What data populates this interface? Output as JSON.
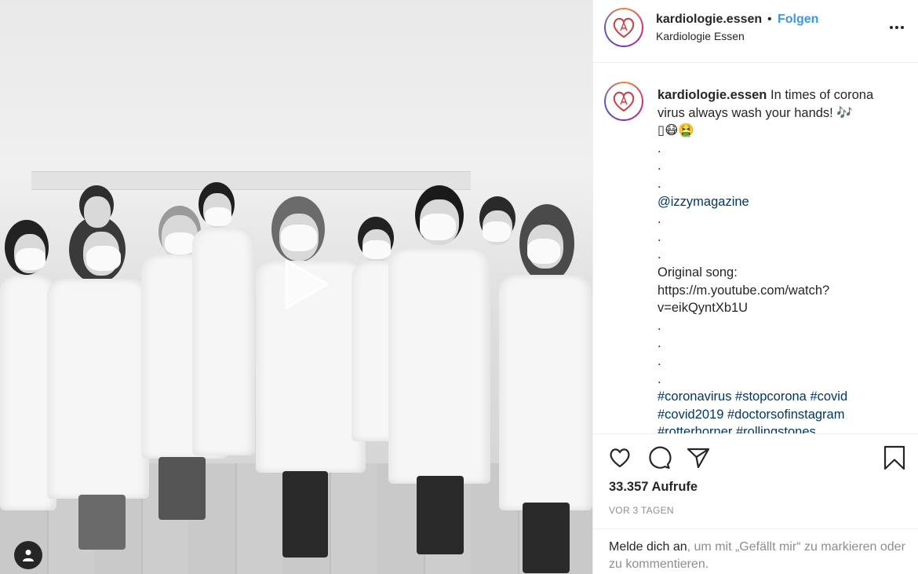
{
  "post": {
    "username": "kardiologie.essen",
    "separator": "•",
    "follow_label": "Folgen",
    "location": "Kardiologie Essen",
    "more_icon": "more-horizontal-icon"
  },
  "media": {
    "type": "video",
    "play_icon": "play-icon",
    "user_tag_icon": "user-tag-icon"
  },
  "caption": {
    "username": "kardiologie.essen",
    "lines": [
      "In times of corona",
      "virus always wash your hands! 🎶",
      "▯😷🤮",
      ".",
      ".",
      ".",
      "@izzymagazine",
      ".",
      ".",
      ".",
      "Original song:",
      "https://m.youtube.com/watch?",
      "v=eikQyntXb1U",
      ".",
      ".",
      ".",
      ".",
      "#coronavirus #stopcorona #covid",
      "#covid2019 #doctorsofinstagram",
      "#rotterhorner #rollingstones"
    ]
  },
  "actions": {
    "like_icon": "heart-icon",
    "comment_icon": "comment-icon",
    "share_icon": "share-icon",
    "save_icon": "bookmark-icon",
    "views": "33.357 Aufrufe",
    "timestamp": "VOR 3 TAGEN",
    "login_link": "Melde dich an",
    "login_rest": ", um mit „Gefällt mir“ zu markieren oder zu kommentieren."
  },
  "colors": {
    "link_blue": "#3897f0",
    "hashtag": "#00376b",
    "text": "#262626",
    "muted": "#8e8e8e"
  }
}
